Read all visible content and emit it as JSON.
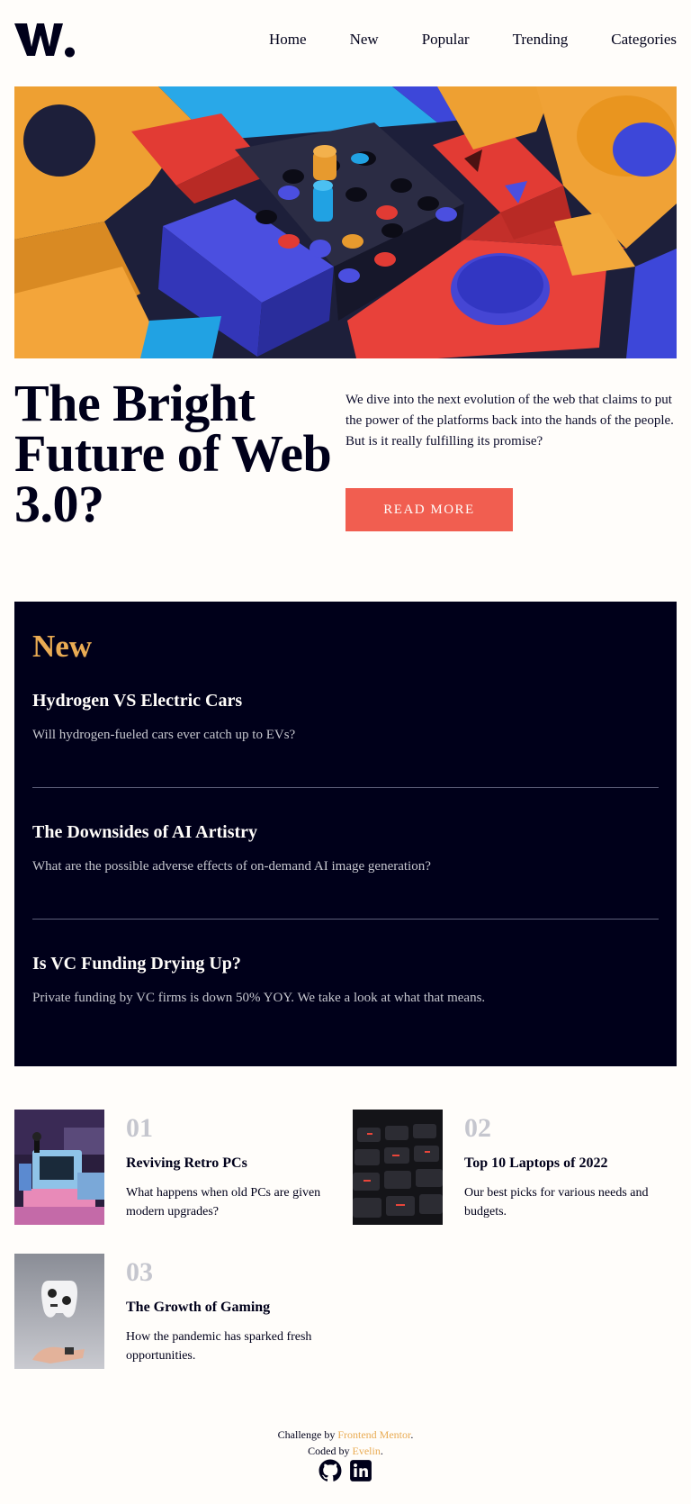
{
  "logo": {
    "text": "W."
  },
  "nav": {
    "items": [
      "Home",
      "New",
      "Popular",
      "Trending",
      "Categories"
    ]
  },
  "hero": {
    "title": "The Bright Future of Web 3.0?",
    "description": "We dive into the next evolution of the web that claims to put the power of the platforms back into the hands of the people. But is it really fulfilling its promise?",
    "cta_label": "READ MORE"
  },
  "new_section": {
    "title": "New",
    "items": [
      {
        "title": "Hydrogen VS Electric Cars",
        "text": "Will hydrogen-fueled cars ever catch up to EVs?"
      },
      {
        "title": "The Downsides of AI Artistry",
        "text": "What are the possible adverse effects of on-demand AI image generation?"
      },
      {
        "title": "Is VC Funding Drying Up?",
        "text": "Private funding by VC firms is down 50% YOY. We take a look at what that means."
      }
    ]
  },
  "articles": [
    {
      "number": "01",
      "title": "Reviving Retro PCs",
      "text": "What happens when old PCs are given modern upgrades?"
    },
    {
      "number": "02",
      "title": "Top 10 Laptops of 2022",
      "text": "Our best picks for various needs and budgets."
    },
    {
      "number": "03",
      "title": "The Growth of Gaming",
      "text": "How the pandemic has sparked fresh opportunities."
    }
  ],
  "footer": {
    "challenge_prefix": "Challenge by ",
    "challenge_link": "Frontend Mentor",
    "coded_prefix": "Coded by ",
    "coded_link": "Evelin",
    "period": "."
  },
  "icons": {
    "github": "github-icon",
    "linkedin": "linkedin-icon"
  },
  "colors": {
    "background": "#fffdfa",
    "dark": "#00001a",
    "accent_red": "#f15e50",
    "accent_orange": "#e9ab53",
    "muted": "#c5c6ce"
  }
}
